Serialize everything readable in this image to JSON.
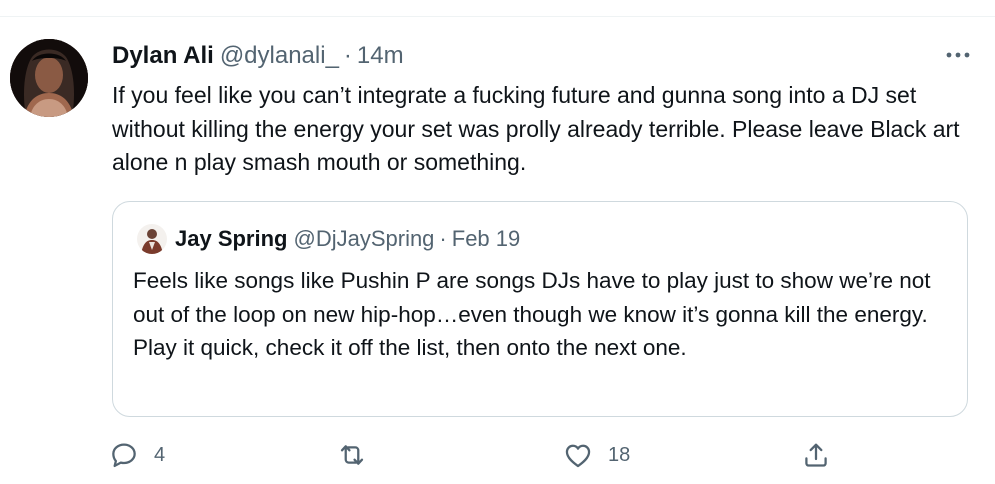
{
  "tweet": {
    "author_name": "Dylan Ali",
    "author_handle": "@dylanali_",
    "separator": "·",
    "time": "14m",
    "text": "If you feel like you can’t integrate a fucking future and gunna song into a DJ set without killing the energy your set was prolly already terrible. Please leave Black art alone n play smash mouth or something.",
    "more_icon": "more-horizontal-icon"
  },
  "quoted_tweet": {
    "author_name": "Jay Spring",
    "author_handle": "@DjJaySpring",
    "separator": "·",
    "time": "Feb 19",
    "text": "Feels like songs like Pushin P are songs DJs have to play just to show we’re not out of the loop on new hip-hop…even though we know it’s gonna kill the energy.  Play it quick, check it off the list, then onto the next one."
  },
  "actions": {
    "reply_count": "4",
    "retweet_count": "",
    "like_count": "18",
    "share_count": ""
  },
  "colors": {
    "text_primary": "#0f1419",
    "text_secondary": "#536471",
    "border": "#cfd9de"
  }
}
